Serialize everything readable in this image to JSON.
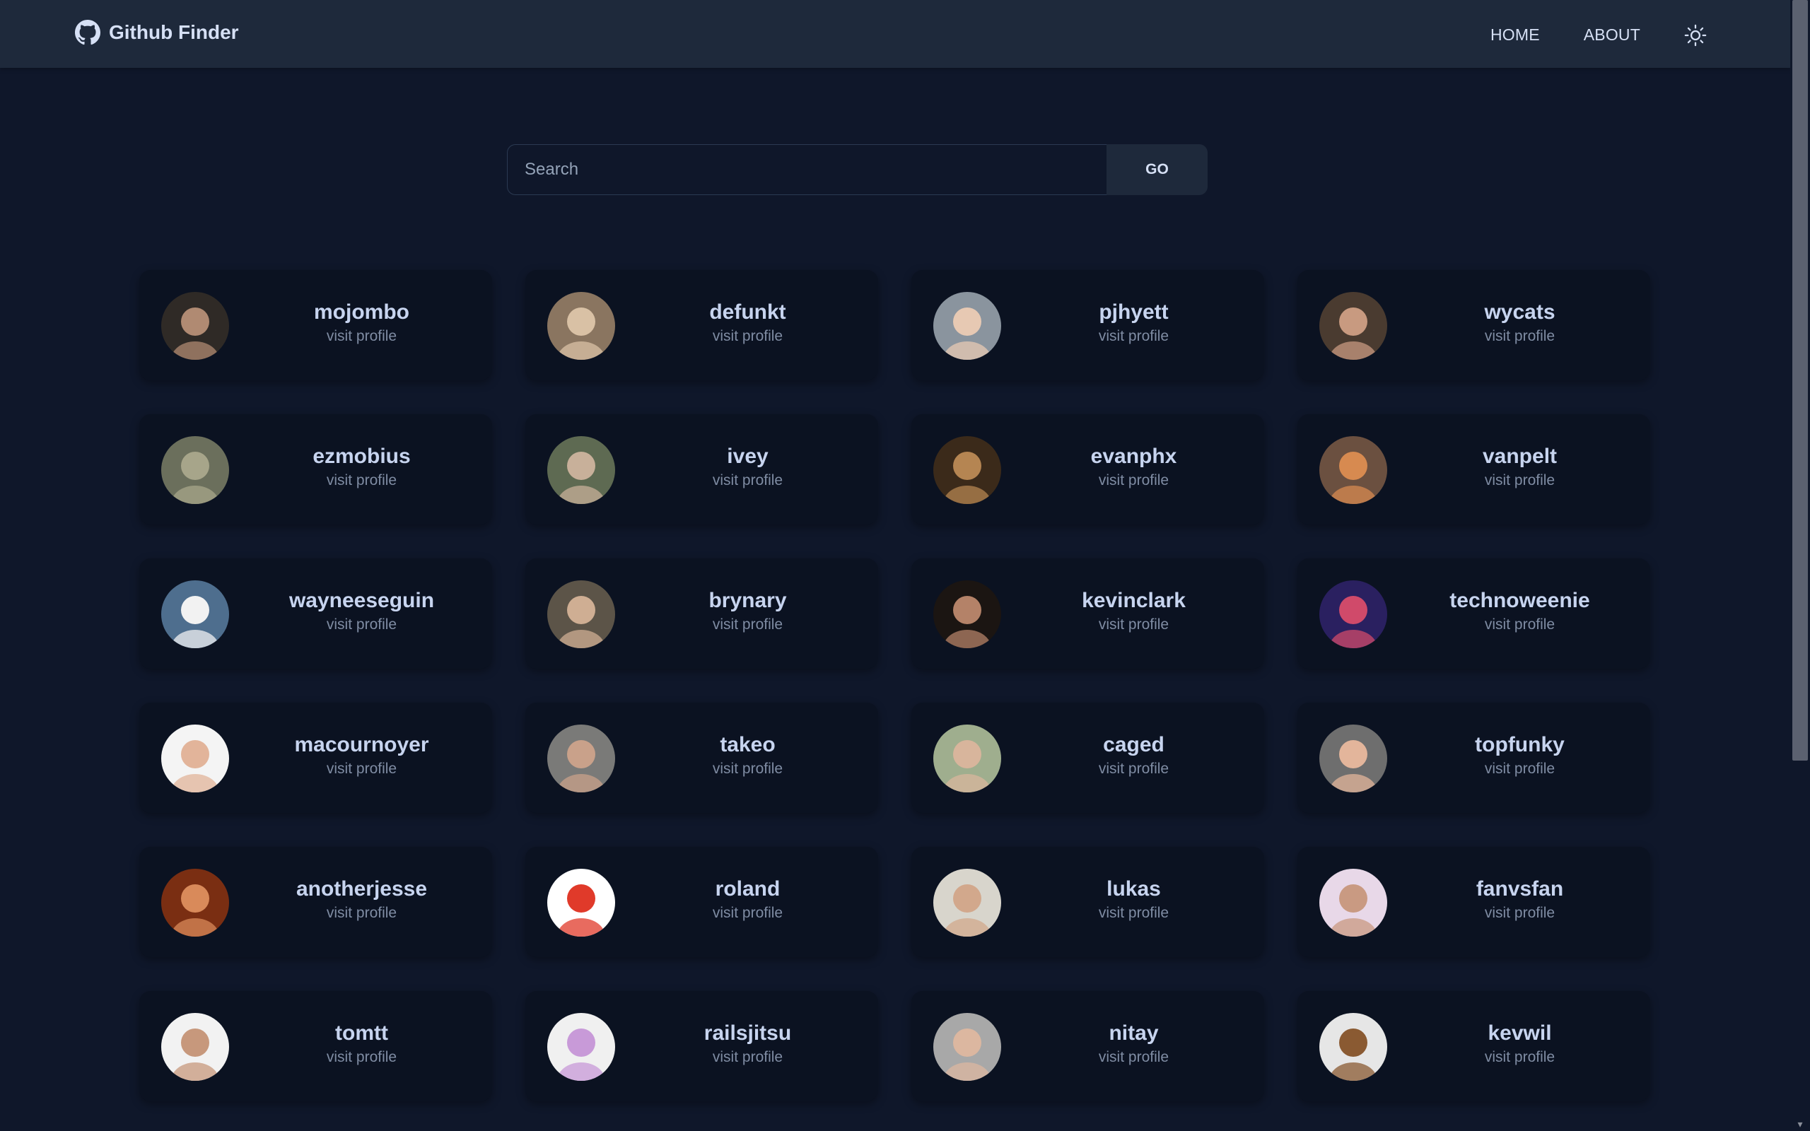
{
  "navbar": {
    "brand_title": "Github Finder",
    "brand_icon": "github-icon",
    "links": {
      "home": "HOME",
      "about": "ABOUT"
    },
    "theme_icon": "sun-icon"
  },
  "search": {
    "placeholder": "Search",
    "button_label": "GO"
  },
  "colors": {
    "background": "#0f172a",
    "navbar": "#1e293b",
    "card": "#0b1221",
    "text": "#d6e0f5",
    "muted": "#7f8ca3"
  },
  "users": [
    {
      "login": "mojombo",
      "link": "visit profile",
      "avatar_bg": "#2f2a26",
      "avatar_fg": "#b08a72"
    },
    {
      "login": "defunkt",
      "link": "visit profile",
      "avatar_bg": "#8a7560",
      "avatar_fg": "#d9c1a5"
    },
    {
      "login": "pjhyett",
      "link": "visit profile",
      "avatar_bg": "#8a949e",
      "avatar_fg": "#e7c9b3"
    },
    {
      "login": "wycats",
      "link": "visit profile",
      "avatar_bg": "#4a3b30",
      "avatar_fg": "#c89a80"
    },
    {
      "login": "ezmobius",
      "link": "visit profile",
      "avatar_bg": "#6b6f5c",
      "avatar_fg": "#a7a58a"
    },
    {
      "login": "ivey",
      "link": "visit profile",
      "avatar_bg": "#5e6a52",
      "avatar_fg": "#c8b09a"
    },
    {
      "login": "evanphx",
      "link": "visit profile",
      "avatar_bg": "#3b2a1a",
      "avatar_fg": "#b58552"
    },
    {
      "login": "vanpelt",
      "link": "visit profile",
      "avatar_bg": "#6b5040",
      "avatar_fg": "#d78a50"
    },
    {
      "login": "wayneeseguin",
      "link": "visit profile",
      "avatar_bg": "#4e6e8e",
      "avatar_fg": "#f2f2f2"
    },
    {
      "login": "brynary",
      "link": "visit profile",
      "avatar_bg": "#5c5448",
      "avatar_fg": "#cfae93"
    },
    {
      "login": "kevinclark",
      "link": "visit profile",
      "avatar_bg": "#1b1512",
      "avatar_fg": "#b48268"
    },
    {
      "login": "technoweenie",
      "link": "visit profile",
      "avatar_bg": "#2a2060",
      "avatar_fg": "#d04a6a"
    },
    {
      "login": "macournoyer",
      "link": "visit profile",
      "avatar_bg": "#f4f4f4",
      "avatar_fg": "#e2b49a"
    },
    {
      "login": "takeo",
      "link": "visit profile",
      "avatar_bg": "#7a7a78",
      "avatar_fg": "#c9a18a"
    },
    {
      "login": "caged",
      "link": "visit profile",
      "avatar_bg": "#9fae8e",
      "avatar_fg": "#d8b59c"
    },
    {
      "login": "topfunky",
      "link": "visit profile",
      "avatar_bg": "#6e6e6e",
      "avatar_fg": "#e3b59b"
    },
    {
      "login": "anotherjesse",
      "link": "visit profile",
      "avatar_bg": "#7a2e12",
      "avatar_fg": "#d98a5a"
    },
    {
      "login": "roland",
      "link": "visit profile",
      "avatar_bg": "#ffffff",
      "avatar_fg": "#e03a2a"
    },
    {
      "login": "lukas",
      "link": "visit profile",
      "avatar_bg": "#d8d5cc",
      "avatar_fg": "#d2a88c"
    },
    {
      "login": "fanvsfan",
      "link": "visit profile",
      "avatar_bg": "#e8d8e8",
      "avatar_fg": "#c99a82"
    },
    {
      "login": "tomtt",
      "link": "visit profile",
      "avatar_bg": "#f2f2f2",
      "avatar_fg": "#c7987c"
    },
    {
      "login": "railsjitsu",
      "link": "visit profile",
      "avatar_bg": "#f0f0f0",
      "avatar_fg": "#c89ad8"
    },
    {
      "login": "nitay",
      "link": "visit profile",
      "avatar_bg": "#a8a8a8",
      "avatar_fg": "#dcb7a0"
    },
    {
      "login": "kevwil",
      "link": "visit profile",
      "avatar_bg": "#e6e6e6",
      "avatar_fg": "#8a5a32"
    }
  ]
}
